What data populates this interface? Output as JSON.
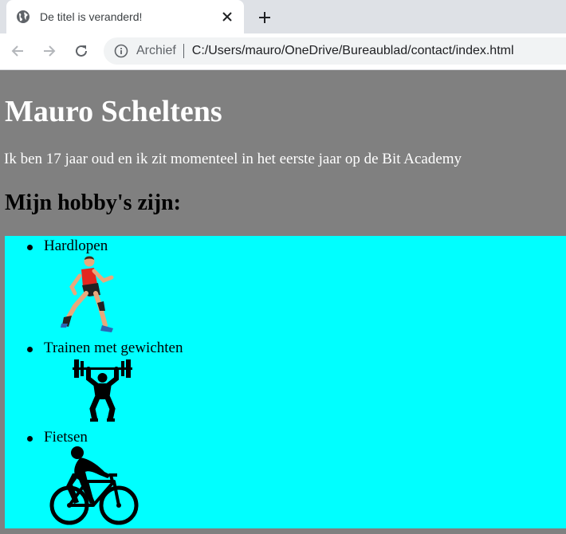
{
  "browser": {
    "tab": {
      "title": "De titel is veranderd!"
    },
    "address_bar": {
      "chip": "Archief",
      "url": "C:/Users/mauro/OneDrive/Bureaublad/contact/index.html"
    }
  },
  "page": {
    "name": "Mauro Scheltens",
    "intro": "Ik ben 17 jaar oud en ik zit momenteel in het eerste jaar op de Bit Academy",
    "hobbies_title": "Mijn hobby's zijn:",
    "hobbies": [
      {
        "label": "Hardlopen",
        "icon": "runner-image"
      },
      {
        "label": "Trainen met gewichten",
        "icon": "weightlifter-image"
      },
      {
        "label": "Fietsen",
        "icon": "cyclist-image"
      }
    ]
  },
  "colors": {
    "page_background": "#808080",
    "list_background": "#00ffff",
    "heading_text": "#ffffff",
    "runner_shirt": "#e3281f"
  }
}
